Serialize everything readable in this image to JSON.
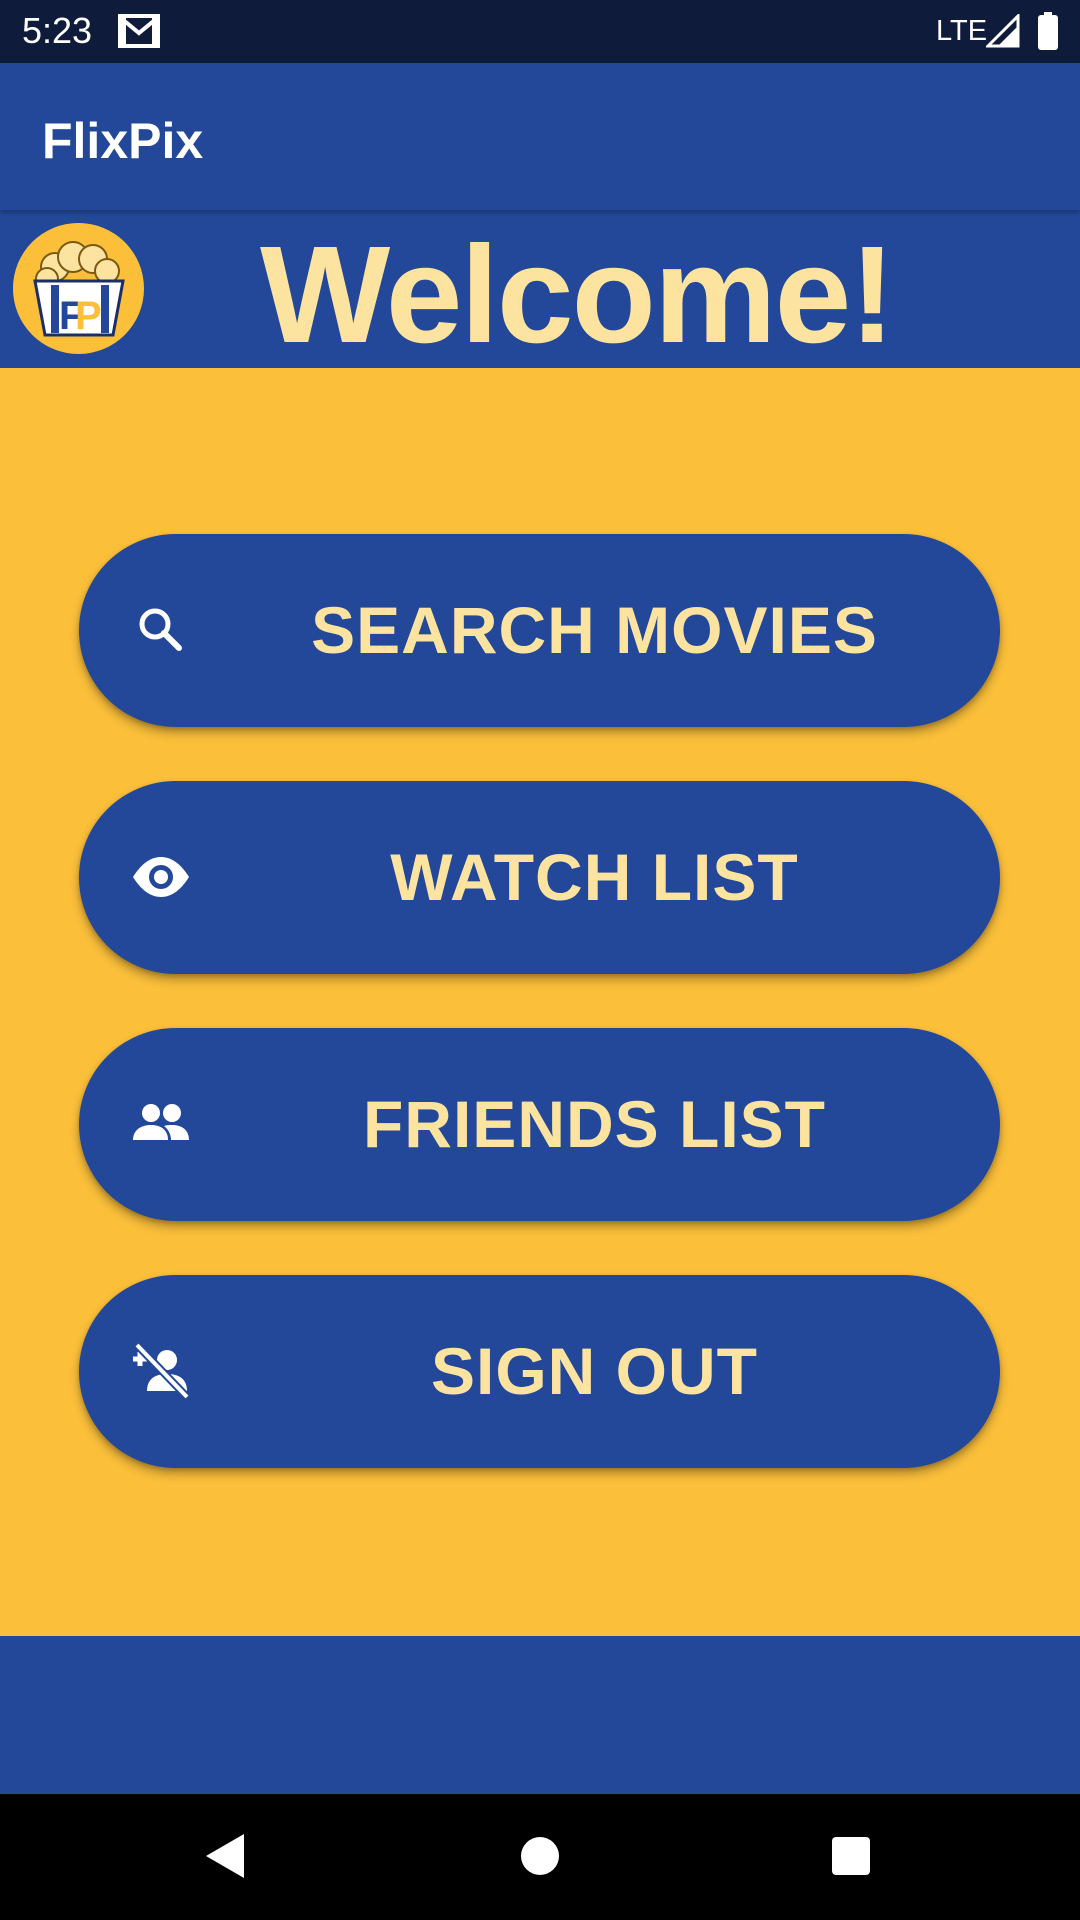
{
  "status_bar": {
    "time": "5:23",
    "network": "LTE",
    "icons": [
      "gmail-icon",
      "signal-icon",
      "battery-icon"
    ]
  },
  "app_bar": {
    "title": "FlixPix"
  },
  "header": {
    "logo_icon": "popcorn-logo-icon",
    "welcome": "Welcome!"
  },
  "menu": {
    "buttons": [
      {
        "label": "SEARCH MOVIES",
        "icon": "search-icon"
      },
      {
        "label": "WATCH LIST",
        "icon": "eye-icon"
      },
      {
        "label": "FRIENDS LIST",
        "icon": "people-icon"
      },
      {
        "label": "SIGN OUT",
        "icon": "person-off-icon"
      }
    ]
  },
  "nav_bar": {
    "icons": [
      "back-icon",
      "home-icon",
      "recents-icon"
    ]
  },
  "colors": {
    "primary": "#234899",
    "background": "#fbbf3a",
    "accent_text": "#fde3a0",
    "status_bar": "#0f1b3b"
  }
}
